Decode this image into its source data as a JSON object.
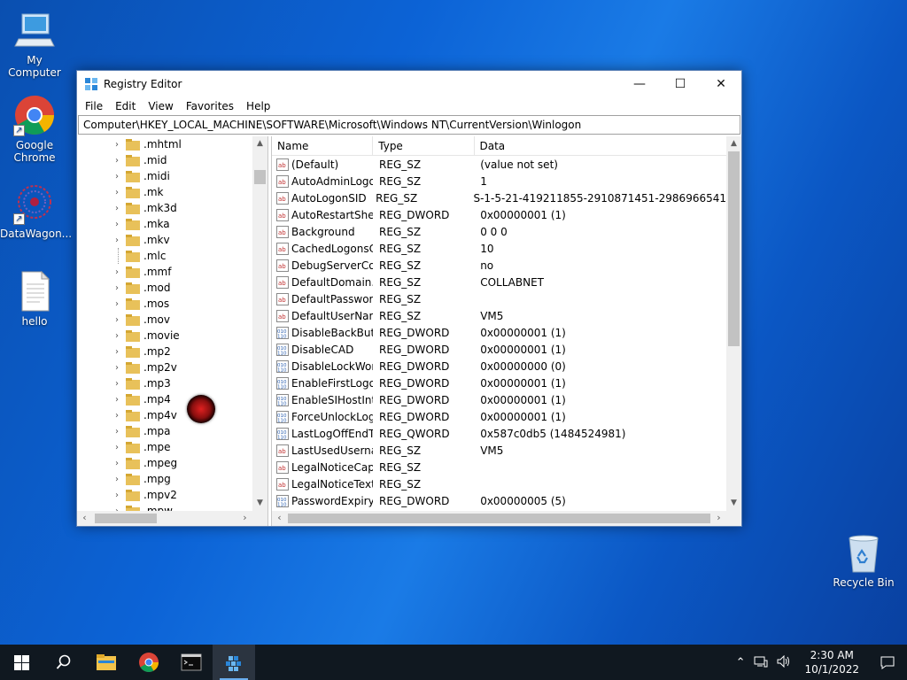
{
  "desktop": {
    "icons": [
      {
        "label": "My Computer"
      },
      {
        "label": "Google Chrome"
      },
      {
        "label": "DataWagon..."
      },
      {
        "label": "hello"
      },
      {
        "label": "Recycle Bin"
      }
    ]
  },
  "window": {
    "title": "Registry Editor",
    "menu": [
      "File",
      "Edit",
      "View",
      "Favorites",
      "Help"
    ],
    "address": "Computer\\HKEY_LOCAL_MACHINE\\SOFTWARE\\Microsoft\\Windows NT\\CurrentVersion\\Winlogon",
    "controls": {
      "minimize": "—",
      "maximize": "☐",
      "close": "✕"
    }
  },
  "tree": {
    "items": [
      ".mhtml",
      ".mid",
      ".midi",
      ".mk",
      ".mk3d",
      ".mka",
      ".mkv",
      ".mlc",
      ".mmf",
      ".mod",
      ".mos",
      ".mov",
      ".movie",
      ".mp2",
      ".mp2v",
      ".mp3",
      ".mp4",
      ".mp4v",
      ".mpa",
      ".mpe",
      ".mpeg",
      ".mpg",
      ".mpv2",
      ".mpw"
    ],
    "no_expander_index": 7
  },
  "list": {
    "headers": {
      "name": "Name",
      "type": "Type",
      "data": "Data"
    },
    "rows": [
      {
        "icon": "string-value-icon",
        "name": "(Default)",
        "type": "REG_SZ",
        "data": "(value not set)"
      },
      {
        "icon": "string-value-icon",
        "name": "AutoAdminLogon",
        "type": "REG_SZ",
        "data": "1"
      },
      {
        "icon": "string-value-icon",
        "name": "AutoLogonSID",
        "type": "REG_SZ",
        "data": "S-1-5-21-419211855-2910871451-2986966541"
      },
      {
        "icon": "string-value-icon",
        "name": "AutoRestartShell",
        "type": "REG_DWORD",
        "data": "0x00000001 (1)"
      },
      {
        "icon": "string-value-icon",
        "name": "Background",
        "type": "REG_SZ",
        "data": "0 0 0"
      },
      {
        "icon": "string-value-icon",
        "name": "CachedLogonsC...",
        "type": "REG_SZ",
        "data": "10"
      },
      {
        "icon": "string-value-icon",
        "name": "DebugServerCo...",
        "type": "REG_SZ",
        "data": "no"
      },
      {
        "icon": "string-value-icon",
        "name": "DefaultDomain...",
        "type": "REG_SZ",
        "data": "COLLABNET"
      },
      {
        "icon": "string-value-icon",
        "name": "DefaultPassword",
        "type": "REG_SZ",
        "data": ""
      },
      {
        "icon": "string-value-icon",
        "name": "DefaultUserName",
        "type": "REG_SZ",
        "data": "VM5"
      },
      {
        "icon": "binary-value-icon",
        "name": "DisableBackButt...",
        "type": "REG_DWORD",
        "data": "0x00000001 (1)"
      },
      {
        "icon": "binary-value-icon",
        "name": "DisableCAD",
        "type": "REG_DWORD",
        "data": "0x00000001 (1)"
      },
      {
        "icon": "binary-value-icon",
        "name": "DisableLockWor...",
        "type": "REG_DWORD",
        "data": "0x00000000 (0)"
      },
      {
        "icon": "binary-value-icon",
        "name": "EnableFirstLogo...",
        "type": "REG_DWORD",
        "data": "0x00000001 (1)"
      },
      {
        "icon": "binary-value-icon",
        "name": "EnableSIHostInt...",
        "type": "REG_DWORD",
        "data": "0x00000001 (1)"
      },
      {
        "icon": "binary-value-icon",
        "name": "ForceUnlockLog...",
        "type": "REG_DWORD",
        "data": "0x00000001 (1)"
      },
      {
        "icon": "binary-value-icon",
        "name": "LastLogOffEndTi...",
        "type": "REG_QWORD",
        "data": "0x587c0db5 (1484524981)"
      },
      {
        "icon": "string-value-icon",
        "name": "LastUsedUserna...",
        "type": "REG_SZ",
        "data": "VM5"
      },
      {
        "icon": "string-value-icon",
        "name": "LegalNoticeCap...",
        "type": "REG_SZ",
        "data": ""
      },
      {
        "icon": "string-value-icon",
        "name": "LegalNoticeText",
        "type": "REG_SZ",
        "data": ""
      },
      {
        "icon": "binary-value-icon",
        "name": "PasswordExpiry...",
        "type": "REG_DWORD",
        "data": "0x00000005 (5)"
      }
    ]
  },
  "taskbar": {
    "apps": [
      "start-button",
      "search-button",
      "file-explorer",
      "chrome",
      "command-prompt",
      "registry-editor"
    ],
    "active_app": "registry-editor",
    "clock": {
      "time": "2:30 AM",
      "date": "10/1/2022"
    }
  },
  "colors": {
    "accent": "#0078d7",
    "folder": "#e8c15a",
    "taskbar": "#101820"
  }
}
